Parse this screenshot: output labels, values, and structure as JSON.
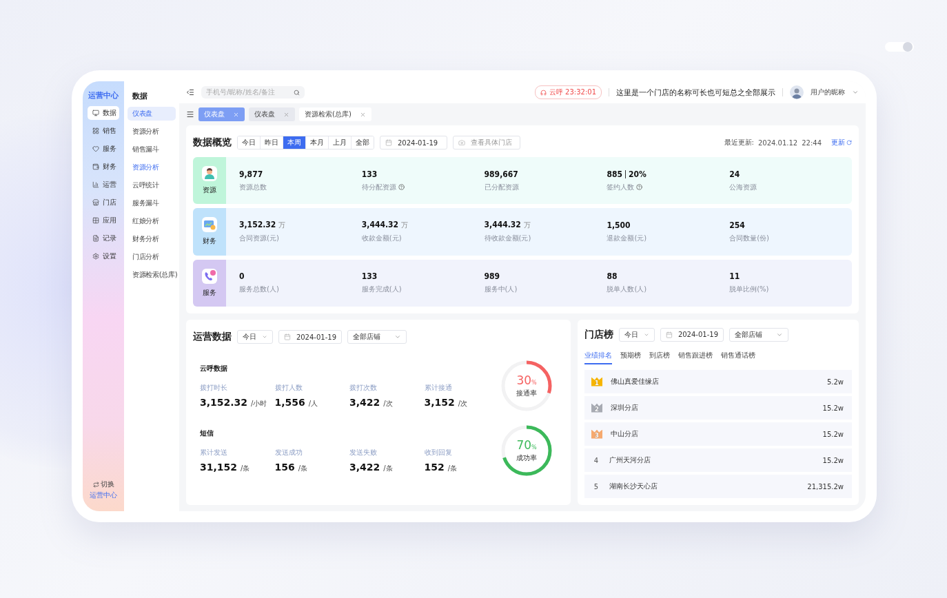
{
  "rail": {
    "title": "运营中心",
    "items": [
      {
        "label": "数据",
        "selected": true
      },
      {
        "label": "销售",
        "selected": false
      },
      {
        "label": "服务",
        "selected": false
      },
      {
        "label": "财务",
        "selected": false
      },
      {
        "label": "运营",
        "selected": false
      },
      {
        "label": "门店",
        "selected": false
      },
      {
        "label": "应用",
        "selected": false
      },
      {
        "label": "记录",
        "selected": false
      },
      {
        "label": "设置",
        "selected": false
      }
    ],
    "switch": {
      "label": "切换",
      "target": "运营中心"
    }
  },
  "submenu": {
    "title": "数据",
    "items": [
      {
        "label": "仪表盘",
        "selected": true,
        "highlighted": false
      },
      {
        "label": "资源分析",
        "selected": false,
        "highlighted": false
      },
      {
        "label": "销售漏斗",
        "selected": false,
        "highlighted": false
      },
      {
        "label": "资源分析",
        "selected": false,
        "highlighted": true
      },
      {
        "label": "云呼统计",
        "selected": false,
        "highlighted": false
      },
      {
        "label": "服务漏斗",
        "selected": false,
        "highlighted": false
      },
      {
        "label": "红娘分析",
        "selected": false,
        "highlighted": false
      },
      {
        "label": "财务分析",
        "selected": false,
        "highlighted": false
      },
      {
        "label": "门店分析",
        "selected": false,
        "highlighted": false
      },
      {
        "label": "资源检索(总库)",
        "selected": false,
        "highlighted": false
      }
    ]
  },
  "header": {
    "search_placeholder": "手机号/昵称/姓名/备注",
    "call": {
      "label": "云呼",
      "time": "23:32:01"
    },
    "store_name": "这里是一个门店的名称可长也可短总之全部展示",
    "user": "用户的昵称"
  },
  "tabs": [
    {
      "label": "仪表盘",
      "selected": true
    },
    {
      "label": "仪表盘",
      "selected": false
    },
    {
      "label": "资源检索(总库)",
      "selected": false
    }
  ],
  "overview": {
    "title": "数据概览",
    "ranges": [
      {
        "label": "今日",
        "selected": false
      },
      {
        "label": "昨日",
        "selected": false
      },
      {
        "label": "本周",
        "selected": true
      },
      {
        "label": "本月",
        "selected": false
      },
      {
        "label": "上月",
        "selected": false
      },
      {
        "label": "全部",
        "selected": false
      }
    ],
    "date": "2024-01-19",
    "store_placeholder": "查看具体门店",
    "updated_label": "最近更新:",
    "updated_date": "2024.01.12",
    "updated_time": "22:44",
    "refresh": "更新",
    "groups": [
      {
        "label": "资源",
        "kind": "resource",
        "color": "#bff5da",
        "stats": [
          {
            "value": "9,877",
            "label": "资源总数",
            "help": false
          },
          {
            "value": "133",
            "label": "待分配资源",
            "help": true
          },
          {
            "value": "989,667",
            "label": "已分配资源",
            "help": false
          },
          {
            "value": "885",
            "extra": "20%",
            "label": "签约人数",
            "help": true
          },
          {
            "value": "24",
            "label": "公海资源",
            "help": false
          }
        ]
      },
      {
        "label": "财务",
        "kind": "finance",
        "color": "#bfe2fb",
        "stats": [
          {
            "value": "3,152.32",
            "unit": "万",
            "label": "合同资源(元)",
            "help": false
          },
          {
            "value": "3,444.32",
            "unit": "万",
            "label": "收款金额(元)",
            "help": false
          },
          {
            "value": "3,444.32",
            "unit": "万",
            "label": "待收款金额(元)",
            "help": false
          },
          {
            "value": "1,500",
            "label": "退款金额(元)",
            "help": false
          },
          {
            "value": "254",
            "label": "合同数量(份)",
            "help": false
          }
        ]
      },
      {
        "label": "服务",
        "kind": "service",
        "color": "#d4c8f2",
        "stats": [
          {
            "value": "0",
            "label": "服务总数(人)",
            "help": false
          },
          {
            "value": "133",
            "label": "服务完成(人)",
            "help": false
          },
          {
            "value": "989",
            "label": "服务中(人)",
            "help": false
          },
          {
            "value": "88",
            "label": "脱单人数(人)",
            "help": false
          },
          {
            "value": "11",
            "label": "脱单比例(%)",
            "help": false
          }
        ]
      }
    ]
  },
  "operations": {
    "title": "运营数据",
    "period": "今日",
    "date": "2024-01-19",
    "store": "全部店铺",
    "sections": [
      {
        "title": "云呼数据",
        "stats": [
          {
            "label": "拨打时长",
            "value": "3,152.32",
            "unit": "/小时"
          },
          {
            "label": "拨打人数",
            "value": "1,556",
            "unit": "/人"
          },
          {
            "label": "拨打次数",
            "value": "3,422",
            "unit": "/次"
          },
          {
            "label": "累计接通",
            "value": "3,152",
            "unit": "/次"
          }
        ],
        "gauge": {
          "value": "30",
          "unit": "%",
          "label": "接通率",
          "level": 0.3,
          "color": "#f56262"
        }
      },
      {
        "title": "短信",
        "stats": [
          {
            "label": "累计发送",
            "value": "31,152",
            "unit": "/条"
          },
          {
            "label": "发送成功",
            "value": "156",
            "unit": "/条"
          },
          {
            "label": "发送失败",
            "value": "3,422",
            "unit": "/条"
          },
          {
            "label": "收到回复",
            "value": "152",
            "unit": "/条"
          }
        ],
        "gauge": {
          "value": "70",
          "unit": "%",
          "label": "成功率",
          "level": 0.7,
          "color": "#3cb95a"
        }
      }
    ]
  },
  "ranking": {
    "title": "门店榜",
    "period": "今日",
    "date": "2024-01-19",
    "store": "全部店铺",
    "tabs": [
      {
        "label": "业绩排名",
        "selected": true
      },
      {
        "label": "预期榜",
        "selected": false
      },
      {
        "label": "到店榜",
        "selected": false
      },
      {
        "label": "销售跟进榜",
        "selected": false
      },
      {
        "label": "销售通话榜",
        "selected": false
      }
    ],
    "rows": [
      {
        "rank": "1",
        "kind": "medal",
        "color": "#f7b500",
        "name": "佛山真爱佳缘店",
        "value": "5.2w"
      },
      {
        "rank": "2",
        "kind": "medal",
        "color": "#a8abb3",
        "name": "深圳分店",
        "value": "15.2w"
      },
      {
        "rank": "3",
        "kind": "medal",
        "color": "#f6a96e",
        "name": "中山分店",
        "value": "15.2w"
      },
      {
        "rank": "4",
        "kind": "plain",
        "name": "广州天河分店",
        "value": "15.2w"
      },
      {
        "rank": "5",
        "kind": "plain",
        "name": "湖南长沙天心店",
        "value": "21,315.2w"
      }
    ]
  }
}
